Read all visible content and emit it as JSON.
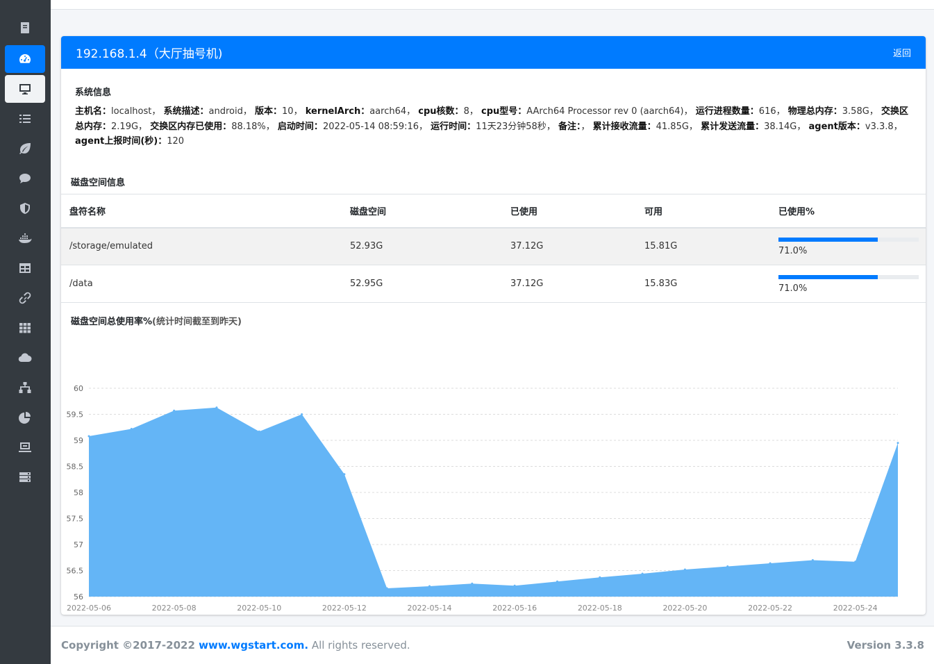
{
  "sidebar": {
    "items": [
      {
        "icon": "book-icon"
      },
      {
        "icon": "dashboard-icon"
      },
      {
        "icon": "desktop-icon"
      },
      {
        "icon": "list-icon"
      },
      {
        "icon": "leaf-icon"
      },
      {
        "icon": "comment-icon"
      },
      {
        "icon": "shield-icon"
      },
      {
        "icon": "docker-icon"
      },
      {
        "icon": "table-icon"
      },
      {
        "icon": "link-icon"
      },
      {
        "icon": "grid-icon"
      },
      {
        "icon": "cloud-icon"
      },
      {
        "icon": "network-icon"
      },
      {
        "icon": "pie-chart-icon"
      },
      {
        "icon": "monitor-icon"
      },
      {
        "icon": "server-icon"
      }
    ]
  },
  "header": {
    "title": "192.168.1.4（大厅抽号机)",
    "back_label": "返回",
    "accent": "#007bff"
  },
  "sysinfo": {
    "title": "系统信息",
    "fields": [
      {
        "label": "主机名",
        "value": "localhost"
      },
      {
        "label": "系统描述",
        "value": "android"
      },
      {
        "label": "版本",
        "value": "10"
      },
      {
        "label": "kernelArch",
        "value": "aarch64"
      },
      {
        "label": "cpu核数",
        "value": "8"
      },
      {
        "label": "cpu型号",
        "value": "AArch64 Processor rev 0 (aarch64)"
      },
      {
        "label": "运行进程数量",
        "value": "616"
      },
      {
        "label": "物理总内存",
        "value": "3.58G"
      },
      {
        "label": "交换区总内存",
        "value": "2.19G"
      },
      {
        "label": "交换区内存已使用",
        "value": "88.18%"
      },
      {
        "label": "启动时间",
        "value": "2022-05-14 08:59:16"
      },
      {
        "label": "运行时间",
        "value": "11天23分钟58秒"
      },
      {
        "label": "备注",
        "value": ""
      },
      {
        "label": "累计接收流量",
        "value": "41.85G"
      },
      {
        "label": "累计发送流量",
        "value": "38.14G"
      },
      {
        "label": "agent版本",
        "value": "v3.3.8"
      },
      {
        "label": "agent上报时间(秒)",
        "value": "120"
      }
    ]
  },
  "disk": {
    "title": "磁盘空间信息",
    "columns": [
      "盘符名称",
      "磁盘空间",
      "已使用",
      "可用",
      "已使用%"
    ],
    "rows": [
      {
        "name": "/storage/emulated",
        "size": "52.93G",
        "used": "37.12G",
        "avail": "15.81G",
        "pct": "71.0%",
        "pct_value": 0.71
      },
      {
        "name": "/data",
        "size": "52.95G",
        "used": "37.12G",
        "avail": "15.83G",
        "pct": "71.0%",
        "pct_value": 0.71
      }
    ]
  },
  "chart": {
    "title": "磁盘空间总使用率%",
    "subtitle": "(统计时间截至到昨天)"
  },
  "chart_data": {
    "type": "area",
    "x": [
      "2022-05-06",
      "2022-05-07",
      "2022-05-08",
      "2022-05-09",
      "2022-05-10",
      "2022-05-11",
      "2022-05-12",
      "2022-05-13",
      "2022-05-14",
      "2022-05-15",
      "2022-05-16",
      "2022-05-17",
      "2022-05-18",
      "2022-05-19",
      "2022-05-20",
      "2022-05-21",
      "2022-05-22",
      "2022-05-23",
      "2022-05-24",
      "2022-05-25"
    ],
    "xticks": [
      "2022-05-06",
      "2022-05-08",
      "2022-05-10",
      "2022-05-12",
      "2022-05-14",
      "2022-05-16",
      "2022-05-18",
      "2022-05-20",
      "2022-05-22",
      "2022-05-24"
    ],
    "values": [
      59.08,
      59.22,
      59.57,
      59.63,
      59.17,
      59.5,
      58.35,
      56.16,
      56.2,
      56.25,
      56.21,
      56.29,
      56.37,
      56.44,
      56.52,
      56.58,
      56.64,
      56.7,
      56.67,
      58.95
    ],
    "ylim": [
      56,
      60
    ],
    "yticks": [
      "60",
      "59.5",
      "59",
      "58.5",
      "58",
      "57.5",
      "57",
      "56.5",
      "56"
    ],
    "grid": true,
    "fill_color": "#64b5f6",
    "xlabel": "",
    "ylabel": ""
  },
  "footer": {
    "copyright": "Copyright ©2017-2022 ",
    "brand": "www.wgstart.com.",
    "rights": " All rights reserved.",
    "version": "Version 3.3.8"
  }
}
